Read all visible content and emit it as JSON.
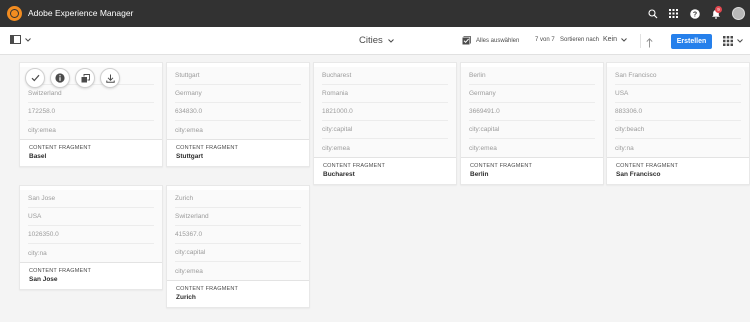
{
  "shell": {
    "brand": "Adobe Experience Manager",
    "notification_count": "9"
  },
  "actionbar": {
    "title": "Cities",
    "select_all": "Alles auswählen",
    "count": "7 von 7",
    "sort_label": "Sortieren nach",
    "sort_value": "Kein",
    "create": "Erstellen"
  },
  "cards": [
    {
      "fields": [
        "Switzerland",
        "172258.0",
        "city:emea"
      ],
      "first_hidden": "Basel",
      "type": "CONTENT FRAGMENT",
      "title": "Basel"
    },
    {
      "fields": [
        "Stuttgart",
        "Germany",
        "634830.0",
        "city:emea"
      ],
      "type": "CONTENT FRAGMENT",
      "title": "Stuttgart"
    },
    {
      "fields": [
        "Bucharest",
        "Romania",
        "1821000.0",
        "city:capital",
        "city:emea"
      ],
      "type": "CONTENT FRAGMENT",
      "title": "Bucharest"
    },
    {
      "fields": [
        "Berlin",
        "Germany",
        "3669491.0",
        "city:capital",
        "city:emea"
      ],
      "type": "CONTENT FRAGMENT",
      "title": "Berlin"
    },
    {
      "fields": [
        "San Francisco",
        "USA",
        "883306.0",
        "city:beach",
        "city:na"
      ],
      "type": "CONTENT FRAGMENT",
      "title": "San Francisco"
    },
    {
      "fields": [
        "San Jose",
        "USA",
        "1026350.0",
        "city:na"
      ],
      "type": "CONTENT FRAGMENT",
      "title": "San Jose"
    },
    {
      "fields": [
        "Zurich",
        "Switzerland",
        "415367.0",
        "city:capital",
        "city:emea"
      ],
      "type": "CONTENT FRAGMENT",
      "title": "Zurich"
    }
  ],
  "quick_actions": {
    "first_field_prefix": "Ba"
  },
  "colors": {
    "shell_bg": "#323232",
    "accent": "#2680eb",
    "logo": "#f28c20",
    "badge": "#e34850"
  }
}
